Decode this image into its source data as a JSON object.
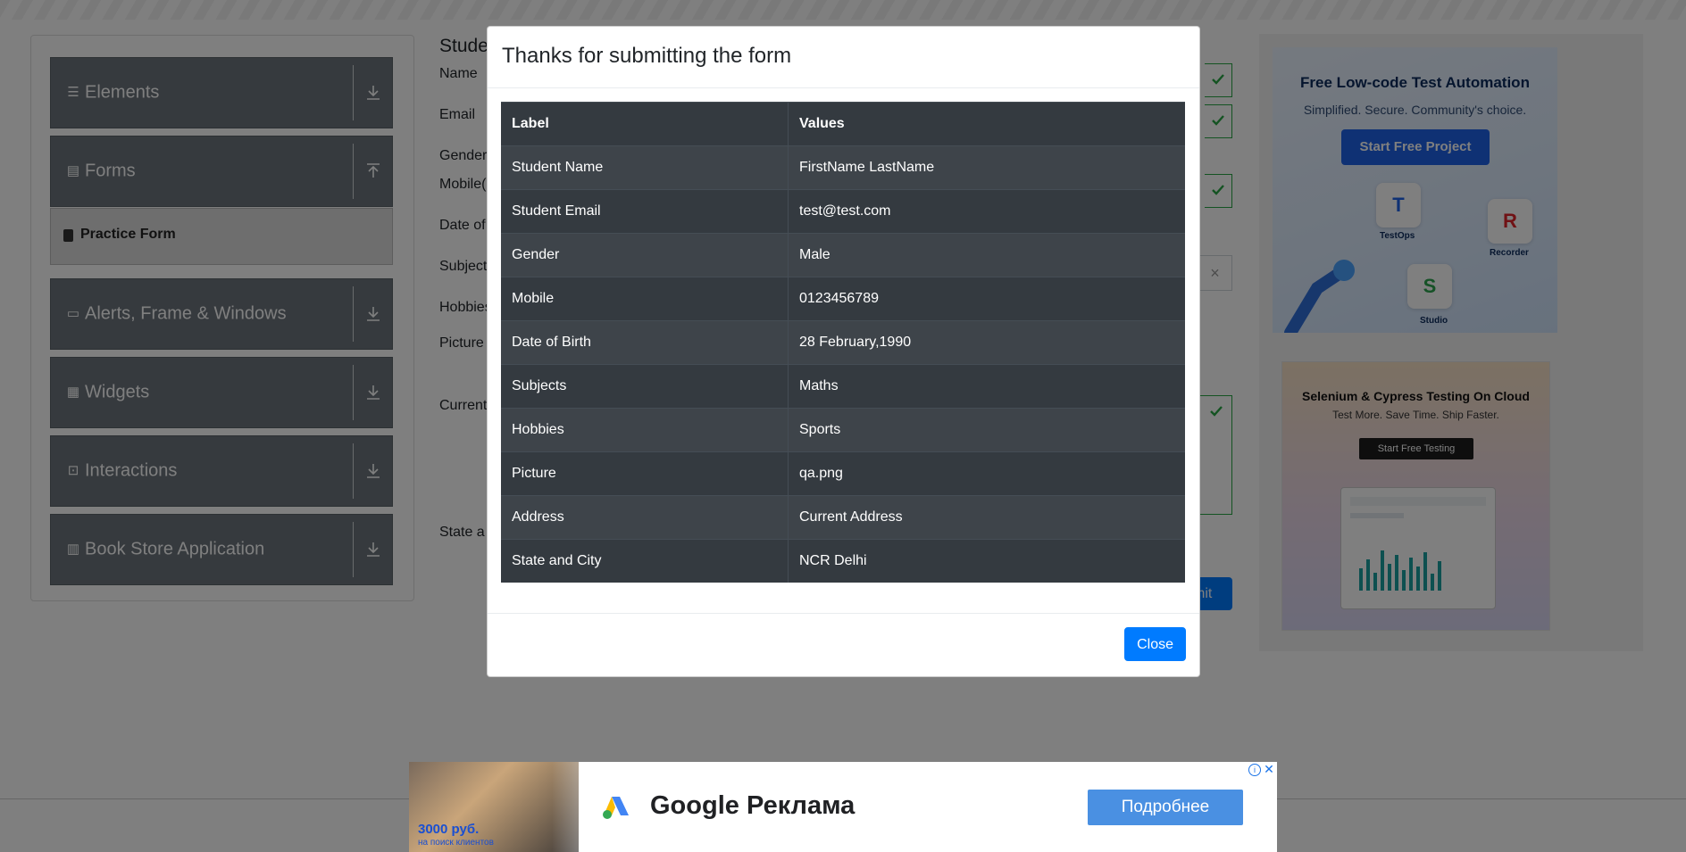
{
  "sidebar": {
    "groups": [
      {
        "label": "Elements",
        "icon": "hamburger-icon"
      },
      {
        "label": "Forms",
        "icon": "document-icon"
      },
      {
        "label": "Alerts, Frame & Windows",
        "icon": "window-icon"
      },
      {
        "label": "Widgets",
        "icon": "widgets-icon"
      },
      {
        "label": "Interactions",
        "icon": "interactions-icon"
      },
      {
        "label": "Book Store Application",
        "icon": "books-icon"
      }
    ],
    "active_item": "Practice Form"
  },
  "form_background": {
    "title": "Stude",
    "labels": [
      "Name",
      "Email",
      "Gender",
      "Mobile(",
      "Date of",
      "Subject",
      "Hobbies",
      "Picture",
      "Current",
      "State a"
    ],
    "submit_partial": "mit"
  },
  "ads": {
    "ad1": {
      "title": "Free Low-code Test Automation",
      "subtitle": "Simplified. Secure. Community's choice.",
      "button": "Start Free Project",
      "tiles": [
        "TestOps",
        "Recorder",
        "Studio"
      ]
    },
    "ad2": {
      "title": "Selenium & Cypress Testing On Cloud",
      "subtitle": "Test More. Save Time. Ship Faster.",
      "button": "Start Free Testing"
    },
    "bottom": {
      "price_line1": "3000 руб.",
      "price_line2": "на поиск клиентов",
      "brand": "Google Реклама",
      "button": "Подробнее"
    }
  },
  "modal": {
    "title": "Thanks for submitting the form",
    "table": {
      "headers": [
        "Label",
        "Values"
      ],
      "rows": [
        [
          "Student Name",
          "FirstName LastName"
        ],
        [
          "Student Email",
          "test@test.com"
        ],
        [
          "Gender",
          "Male"
        ],
        [
          "Mobile",
          "0123456789"
        ],
        [
          "Date of Birth",
          "28 February,1990"
        ],
        [
          "Subjects",
          "Maths"
        ],
        [
          "Hobbies",
          "Sports"
        ],
        [
          "Picture",
          "qa.png"
        ],
        [
          "Address",
          "Current Address"
        ],
        [
          "State and City",
          "NCR Delhi"
        ]
      ]
    },
    "close_label": "Close"
  },
  "colors": {
    "primary": "#007bff",
    "success": "#28a745",
    "table_dark": "#343a40",
    "sidebar_group": "#6c757d"
  }
}
